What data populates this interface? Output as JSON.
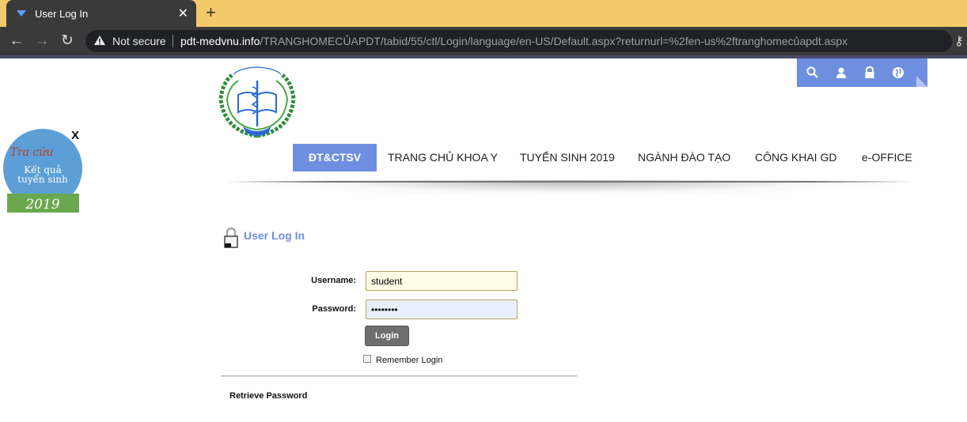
{
  "browser": {
    "tab_title": "User Log In",
    "tab_close": "✕",
    "new_tab": "+",
    "security_label": "Not secure",
    "url_host": "pdt-medvnu.info",
    "url_path": "/TRANGHOMECỦAPDT/tabid/55/ctl/Login/language/en-US/Default.aspx?returnurl=%2fen-us%2ftranghomecủapdt.aspx"
  },
  "header": {
    "toolbar_icons": [
      "search-icon",
      "user-icon",
      "lock-icon",
      "globe-icon"
    ],
    "accent_color": "#6e8fe0"
  },
  "menu": {
    "items": [
      "ĐT&CTSV",
      "TRANG CHỦ KHOA Y",
      "TUYỂN SINH 2019",
      "NGÀNH ĐÀO TẠO",
      "CÔNG KHAI GD",
      "e-OFFICE"
    ]
  },
  "popup": {
    "close": "X"
  },
  "login": {
    "title": "User Log In",
    "username_label": "Username:",
    "username_value": "student",
    "password_label": "Password:",
    "password_value": "••••••••",
    "login_button": "Login",
    "remember_label": "Remember Login",
    "retrieve_link": "Retrieve Password"
  }
}
